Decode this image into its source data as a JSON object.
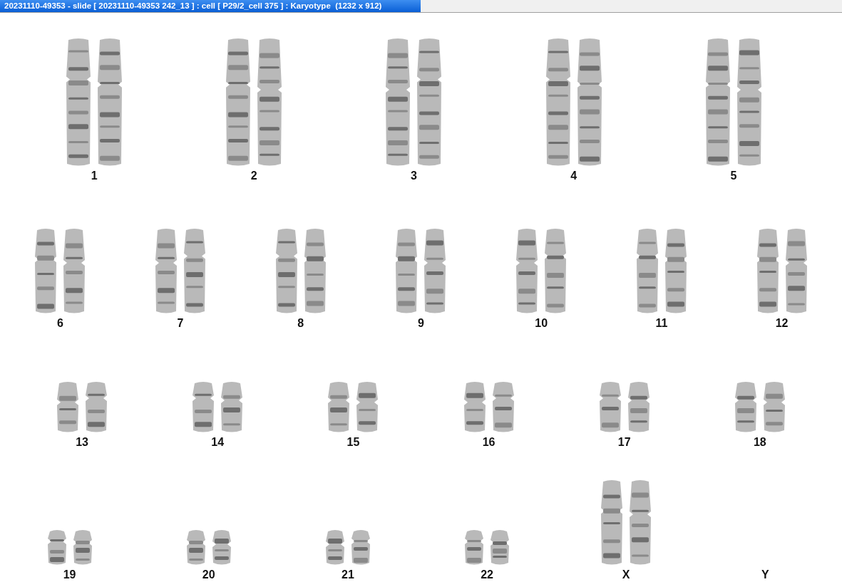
{
  "window": {
    "title": "20231110-49353 - slide [ 20231110-49353 242_13 ] : cell [ P29/2_cell 375 ] : Karyotype  (1232 x 912)"
  },
  "karyotype_rows": [
    [
      {
        "label": "1",
        "kind": "large",
        "has_image": true
      },
      {
        "label": "2",
        "kind": "large",
        "has_image": true
      },
      {
        "label": "3",
        "kind": "large",
        "has_image": true
      },
      {
        "label": "4",
        "kind": "large",
        "has_image": true
      },
      {
        "label": "5",
        "kind": "large",
        "has_image": true
      }
    ],
    [
      {
        "label": "6",
        "kind": "medium",
        "has_image": true
      },
      {
        "label": "7",
        "kind": "medium",
        "has_image": true
      },
      {
        "label": "8",
        "kind": "medium",
        "has_image": true
      },
      {
        "label": "9",
        "kind": "medium",
        "has_image": true
      },
      {
        "label": "10",
        "kind": "medium",
        "has_image": true
      },
      {
        "label": "11",
        "kind": "medium",
        "has_image": true
      },
      {
        "label": "12",
        "kind": "medium",
        "has_image": true
      }
    ],
    [
      {
        "label": "13",
        "kind": "small",
        "has_image": true
      },
      {
        "label": "14",
        "kind": "small",
        "has_image": true
      },
      {
        "label": "15",
        "kind": "small",
        "has_image": true
      },
      {
        "label": "16",
        "kind": "small",
        "has_image": true
      },
      {
        "label": "17",
        "kind": "small",
        "has_image": true
      },
      {
        "label": "18",
        "kind": "small",
        "has_image": true
      }
    ],
    [
      {
        "label": "19",
        "kind": "tiny",
        "has_image": true
      },
      {
        "label": "20",
        "kind": "tiny",
        "has_image": true
      },
      {
        "label": "21",
        "kind": "tiny",
        "has_image": true
      },
      {
        "label": "22",
        "kind": "tiny",
        "has_image": true
      },
      {
        "label": "X",
        "kind": "medium",
        "has_image": true
      },
      {
        "label": "Y",
        "kind": "tiny",
        "has_image": false
      }
    ]
  ]
}
